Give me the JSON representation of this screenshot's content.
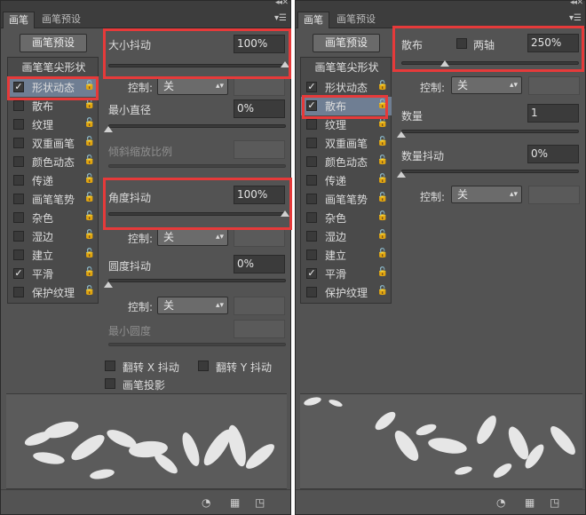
{
  "left": {
    "tabs": [
      "画笔",
      "画笔预设"
    ],
    "preset_button": "画笔预设",
    "list_header": "画笔笔尖形状",
    "items": [
      {
        "label": "形状动态",
        "checked": true,
        "selected": true
      },
      {
        "label": "散布",
        "checked": false
      },
      {
        "label": "纹理",
        "checked": false
      },
      {
        "label": "双重画笔",
        "checked": false
      },
      {
        "label": "颜色动态",
        "checked": false
      },
      {
        "label": "传递",
        "checked": false
      },
      {
        "label": "画笔笔势",
        "checked": false
      },
      {
        "label": "杂色",
        "checked": false
      },
      {
        "label": "湿边",
        "checked": false
      },
      {
        "label": "建立",
        "checked": false
      },
      {
        "label": "平滑",
        "checked": true
      },
      {
        "label": "保护纹理",
        "checked": false
      }
    ],
    "size_jitter": {
      "label": "大小抖动",
      "value": "100%",
      "level": 1.0
    },
    "control_label": "控制:",
    "control_value": "关",
    "min_diameter": {
      "label": "最小直径",
      "value": "0%",
      "level": 0.0
    },
    "tilt_scale": {
      "label": "倾斜缩放比例"
    },
    "angle_jitter": {
      "label": "角度抖动",
      "value": "100%",
      "level": 1.0
    },
    "roundness_jitter": {
      "label": "圆度抖动",
      "value": "0%",
      "level": 0.0
    },
    "min_roundness": {
      "label": "最小圆度"
    },
    "flip_x": "翻转 X 抖动",
    "flip_y": "翻转 Y 抖动",
    "brush_projection": "画笔投影"
  },
  "right": {
    "tabs": [
      "画笔",
      "画笔预设"
    ],
    "preset_button": "画笔预设",
    "list_header": "画笔笔尖形状",
    "items": [
      {
        "label": "形状动态",
        "checked": true
      },
      {
        "label": "散布",
        "checked": true,
        "selected": true
      },
      {
        "label": "纹理",
        "checked": false
      },
      {
        "label": "双重画笔",
        "checked": false
      },
      {
        "label": "颜色动态",
        "checked": false
      },
      {
        "label": "传递",
        "checked": false
      },
      {
        "label": "画笔笔势",
        "checked": false
      },
      {
        "label": "杂色",
        "checked": false
      },
      {
        "label": "湿边",
        "checked": false
      },
      {
        "label": "建立",
        "checked": false
      },
      {
        "label": "平滑",
        "checked": true
      },
      {
        "label": "保护纹理",
        "checked": false
      }
    ],
    "scatter": {
      "label": "散布",
      "both_axes_label": "两轴",
      "value": "250%",
      "level": 0.25
    },
    "control_label": "控制:",
    "control_value": "关",
    "count": {
      "label": "数量",
      "value": "1",
      "level": 0.0
    },
    "count_jitter": {
      "label": "数量抖动",
      "value": "0%",
      "level": 0.0
    }
  },
  "colors": {
    "highlight": "#e63a3a",
    "selected_row": "#6f7e93",
    "panel_bg": "#535353"
  },
  "icons": {
    "checkmark": "✓",
    "lock": "🔓",
    "menu": "▾☰",
    "collapse": "◂◂",
    "close": "✕"
  }
}
